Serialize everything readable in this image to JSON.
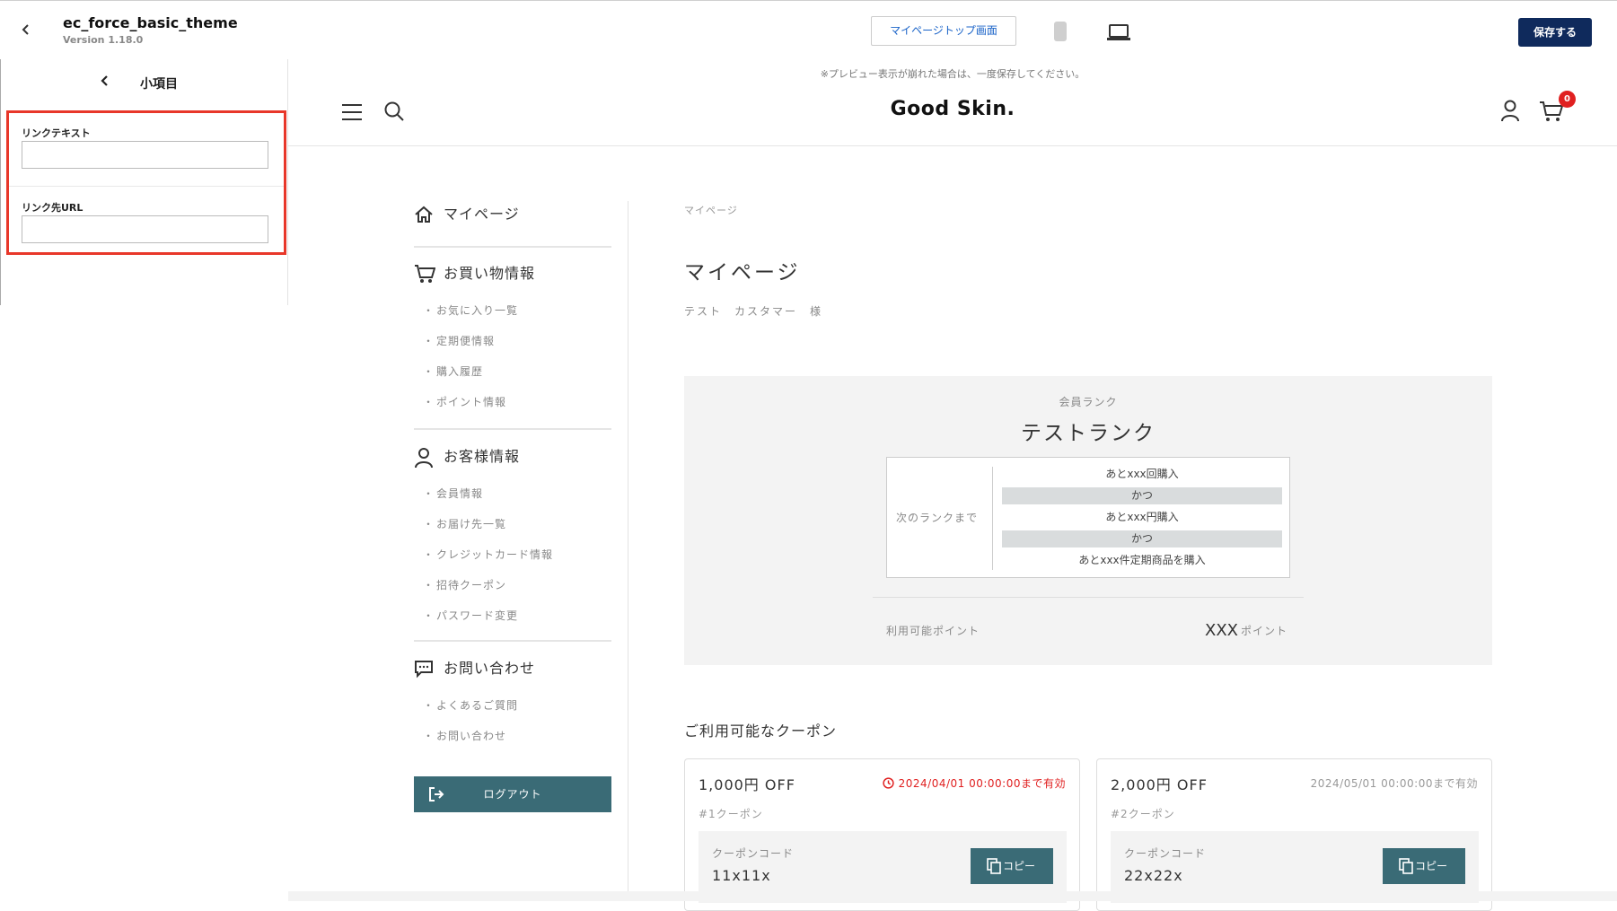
{
  "editor": {
    "theme_name": "ec_force_basic_theme",
    "version": "Version 1.18.0",
    "page_select": "マイページトップ画面",
    "save_label": "保存する"
  },
  "panel": {
    "back": "‹",
    "title": "小項目",
    "fields": [
      {
        "label": "リンクテキスト",
        "value": ""
      },
      {
        "label": "リンク先URL",
        "value": ""
      }
    ],
    "highlight_color": "#e8372a"
  },
  "preview": {
    "notice": "※プレビュー表示が崩れた場合は、一度保存してください。",
    "logo": "Good Skin.",
    "cart_count": "0",
    "nav": {
      "mypage": "マイページ",
      "shopping": {
        "title": "お買い物情報",
        "items": [
          "お気に入り一覧",
          "定期便情報",
          "購入履歴",
          "ポイント情報"
        ]
      },
      "customer": {
        "title": "お客様情報",
        "items": [
          "会員情報",
          "お届け先一覧",
          "クレジットカード情報",
          "招待クーポン",
          "パスワード変更"
        ]
      },
      "contact": {
        "title": "お問い合わせ",
        "items": [
          "よくあるご質問",
          "お問い合わせ"
        ]
      },
      "logout": "ログアウト"
    },
    "breadcrumb": "マイページ",
    "page_title": "マイページ",
    "customer_name": "テスト　カスタマー　様",
    "rank": {
      "label": "会員ランク",
      "name": "テストランク",
      "next_label": "次のランクまで",
      "conditions": [
        "あとxxx回購入",
        "かつ",
        "あとxxx円購入",
        "かつ",
        "あとxxx件定期商品を購入"
      ],
      "points_label": "利用可能ポイント",
      "points_value": "XXX",
      "points_unit": "ポイント"
    },
    "coupons_heading": "ご利用可能なクーポン",
    "coupons": [
      {
        "amount": "1,000円 OFF",
        "valid": "2024/04/01 00:00:00まで有効",
        "number": "#1クーポン",
        "code_label": "クーポンコード",
        "code": "11x11x",
        "copy": "コピー"
      },
      {
        "amount": "2,000円 OFF",
        "valid": "2024/05/01 00:00:00まで有効",
        "number": "#2クーポン",
        "code_label": "クーポンコード",
        "code": "22x22x",
        "copy": "コピー"
      }
    ],
    "accent_color": "#3a6b76",
    "save_color": "#0f2a5c"
  }
}
